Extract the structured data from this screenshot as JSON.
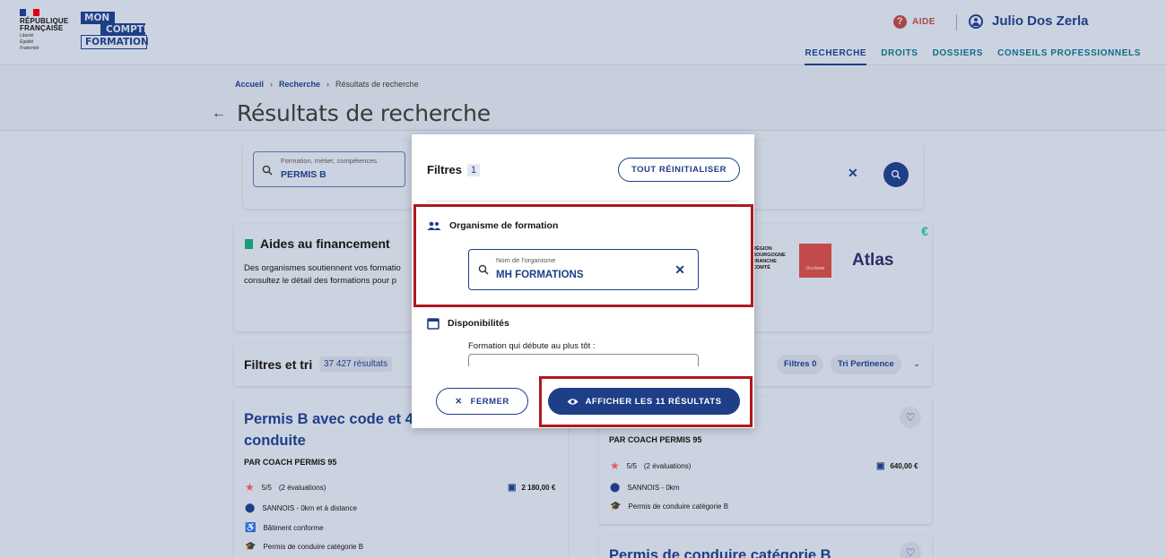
{
  "header": {
    "republique": [
      "RÉPUBLIQUE",
      "FRANÇAISE"
    ],
    "motto": [
      "Liberté",
      "Égalité",
      "Fraternité"
    ],
    "brand": [
      "MON",
      "COMPTE",
      "FORMATION"
    ],
    "help_label": "AIDE",
    "user_name": "Julio Dos Zerla",
    "nav": [
      "RECHERCHE",
      "DROITS",
      "DOSSIERS",
      "CONSEILS PROFESSIONNELS"
    ]
  },
  "breadcrumb": {
    "home": "Accueil",
    "search": "Recherche",
    "current": "Résultats de recherche"
  },
  "page_title": "Résultats de recherche",
  "search": {
    "label": "Formation, métier, compétences",
    "value": "PERMIS B"
  },
  "aid": {
    "title": "Aides au financement",
    "desc_1": "Des organismes soutiennent vos formatio",
    "desc_2": "consultez le détail des formations pour p",
    "region": [
      "RÉGION",
      "BOURGOGNE",
      "FRANCHE",
      "COMTÉ"
    ],
    "occitanie": "Occitanie",
    "atlas": "Atlas",
    "euro": "€"
  },
  "filters_bar": {
    "title": "Filtres et tri",
    "count": "37 427",
    "count_unit": "résultats",
    "chip_filters": "Filtres 0",
    "chip_sort": "Tri Pertinence"
  },
  "results": [
    {
      "title_1": "Permis B avec code et 4",
      "title_2": "conduite",
      "by": "PAR COACH PERMIS 95",
      "rating": "5/5",
      "reviews": "(2 évaluations)",
      "price": "2 180,00 €",
      "location": "SANNOIS - 0km et à distance",
      "access": "Bâtiment conforme",
      "certif": "Permis de conduire catégorie B"
    },
    {
      "by": "PAR COACH PERMIS 95",
      "rating": "5/5",
      "reviews": "(2 évaluations)",
      "price": "640,00 €",
      "location": "SANNOIS - 0km",
      "certif": "Permis de conduire catégorie B"
    },
    {
      "title_1": "Permis de conduire catégorie B"
    }
  ],
  "modal": {
    "title": "Filtres",
    "badge": "1",
    "reset_label": "TOUT RÉINITIALISER",
    "org_section": "Organisme de formation",
    "org_label": "Nom de l'organisme",
    "org_value": "MH FORMATIONS",
    "dispo_section": "Disponibilités",
    "dispo_label": "Formation qui débute au plus tôt :",
    "close_label": "FERMER",
    "show_label": "AFFICHER LES 11 RÉSULTATS"
  },
  "colors": {
    "primary": "#1e3e88",
    "highlight": "#b0181f",
    "accent_green": "#169c7b",
    "marianne_red": "#e1000f"
  }
}
